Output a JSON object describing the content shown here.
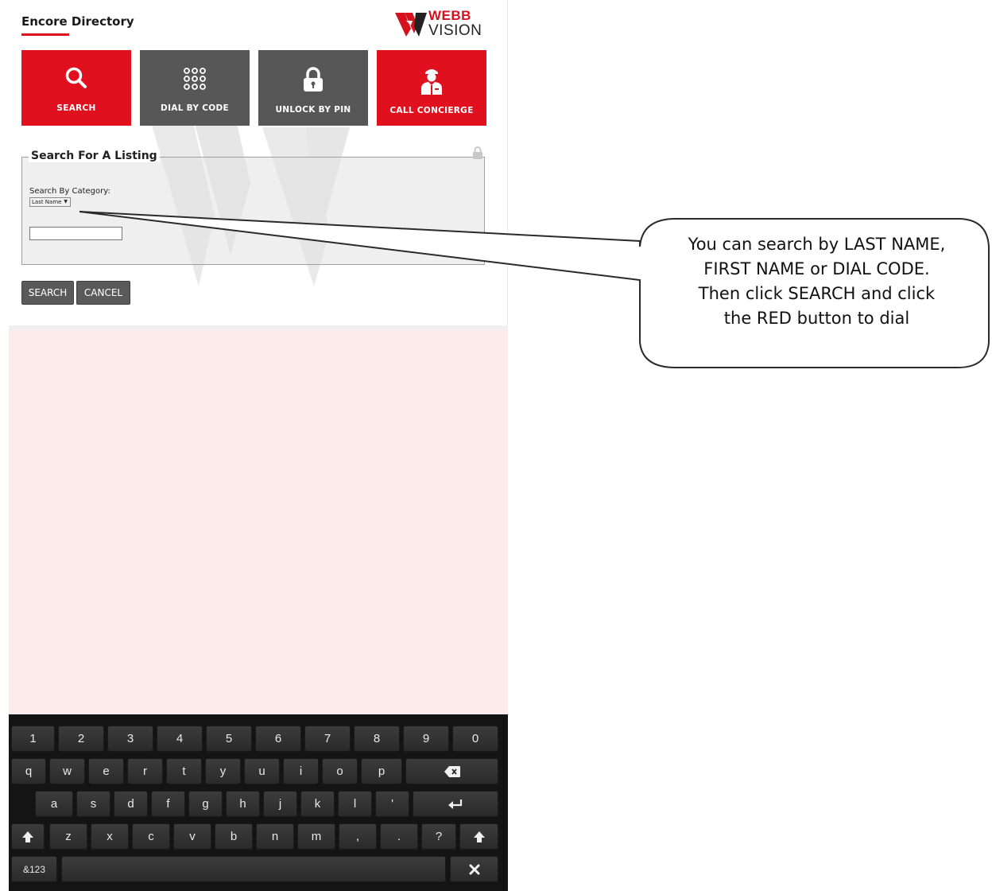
{
  "header": {
    "title": "Encore Directory",
    "logo": {
      "line1": "WEBB",
      "line2": "VISION"
    }
  },
  "tiles": [
    {
      "label": "SEARCH",
      "icon": "search-icon",
      "color": "#e0101e"
    },
    {
      "label": "DIAL BY CODE",
      "icon": "keypad-icon",
      "color": "#575757"
    },
    {
      "label": "UNLOCK BY PIN",
      "icon": "lock-icon",
      "color": "#575757"
    },
    {
      "label": "CALL CONCIERGE",
      "icon": "concierge-icon",
      "color": "#e0101e"
    }
  ],
  "search_form": {
    "legend": "Search For A Listing",
    "category_label": "Search By Category:",
    "category_selected": "Last Name",
    "query_value": "",
    "search_button": "SEARCH",
    "cancel_button": "CANCEL"
  },
  "keyboard": {
    "row1": [
      "1",
      "2",
      "3",
      "4",
      "5",
      "6",
      "7",
      "8",
      "9",
      "0"
    ],
    "row2": [
      "q",
      "w",
      "e",
      "r",
      "t",
      "y",
      "u",
      "i",
      "o",
      "p"
    ],
    "row3": [
      "a",
      "s",
      "d",
      "f",
      "g",
      "h",
      "j",
      "k",
      "l",
      "'"
    ],
    "row4": [
      "z",
      "x",
      "c",
      "v",
      "b",
      "n",
      "m",
      ",",
      ".",
      "?"
    ],
    "symbols_key": "&123"
  },
  "callout": {
    "lines": [
      "You can search by LAST NAME,",
      "FIRST NAME or DIAL CODE.",
      "Then click SEARCH and click",
      "the RED button to dial"
    ]
  },
  "colors": {
    "brand_red": "#e0101e",
    "tile_gray": "#575757",
    "pink_panel": "#fdeaea"
  }
}
